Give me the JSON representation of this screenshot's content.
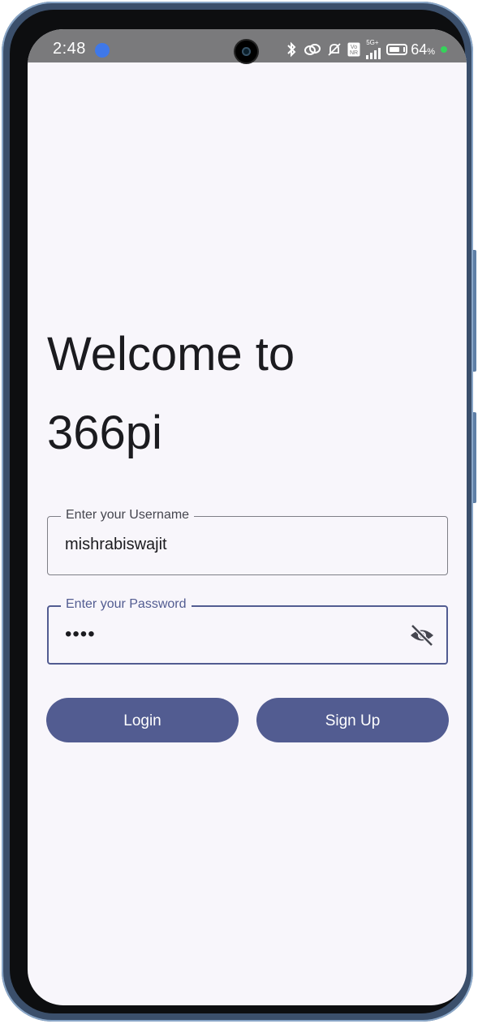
{
  "status_bar": {
    "time": "2:48",
    "battery_percent_text": "64",
    "battery_percent_unit": "%",
    "network_label_top": "5G+",
    "volte_label_top": "Vo",
    "volte_label_bottom": "NR",
    "battery_level": 0.64,
    "charging_color": "#35d35a",
    "icons": [
      "app-notification-icon",
      "bluetooth-icon",
      "link-icon",
      "muted-bell-icon",
      "volte-icon",
      "signal-icon",
      "battery-icon"
    ]
  },
  "login": {
    "title": "Welcome to\n366pi",
    "username": {
      "label": "Enter your Username",
      "value": "mishrabiswajit"
    },
    "password": {
      "label": "Enter your Password",
      "value": "••••",
      "visibility_icon": "eye-off-icon"
    },
    "buttons": {
      "login": "Login",
      "signup": "Sign Up"
    }
  },
  "colors": {
    "primary": "#525c91",
    "background": "#f8f6fb",
    "text": "#1b1b1f",
    "outline": "#7f7f86",
    "status_bar": "#7a7a7c"
  }
}
